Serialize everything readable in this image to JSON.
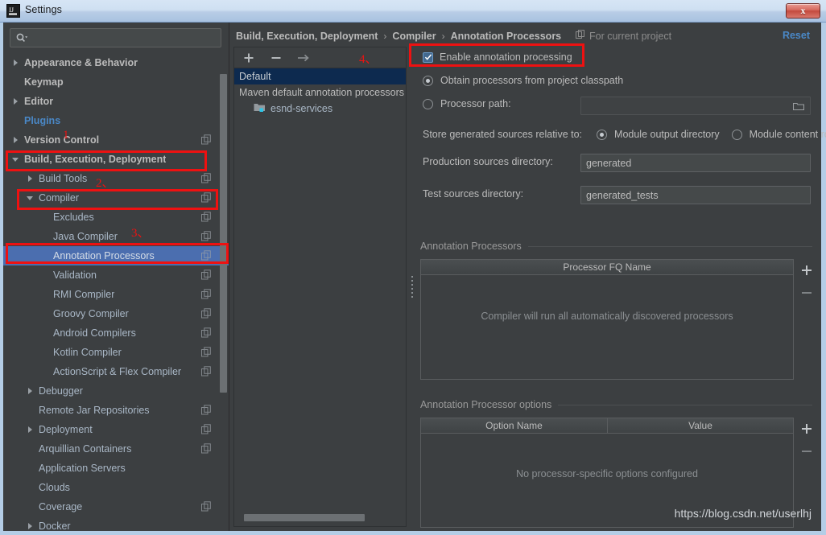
{
  "window": {
    "title": "Settings",
    "icon": "intellij-idea-icon",
    "close_label": "x"
  },
  "search": {
    "placeholder": "",
    "value": "",
    "icon": "search-icon"
  },
  "sidebar": {
    "items": [
      {
        "label": "Appearance & Behavior",
        "indent": 0,
        "arrow": "collapsed",
        "style": "bold",
        "badge": false
      },
      {
        "label": "Keymap",
        "indent": 0,
        "arrow": "none",
        "style": "bold",
        "badge": false
      },
      {
        "label": "Editor",
        "indent": 0,
        "arrow": "collapsed",
        "style": "bold",
        "badge": false
      },
      {
        "label": "Plugins",
        "indent": 0,
        "arrow": "none",
        "style": "accent",
        "badge": false
      },
      {
        "label": "Version Control",
        "indent": 0,
        "arrow": "collapsed",
        "style": "bold",
        "badge": true
      },
      {
        "label": "Build, Execution, Deployment",
        "indent": 0,
        "arrow": "expanded",
        "style": "bold",
        "badge": false
      },
      {
        "label": "Build Tools",
        "indent": 1,
        "arrow": "collapsed",
        "style": "normal",
        "badge": true
      },
      {
        "label": "Compiler",
        "indent": 1,
        "arrow": "expanded",
        "style": "normal",
        "badge": true
      },
      {
        "label": "Excludes",
        "indent": 2,
        "arrow": "none",
        "style": "normal",
        "badge": true
      },
      {
        "label": "Java Compiler",
        "indent": 2,
        "arrow": "none",
        "style": "normal",
        "badge": true
      },
      {
        "label": "Annotation Processors",
        "indent": 2,
        "arrow": "none",
        "style": "selected",
        "badge": true
      },
      {
        "label": "Validation",
        "indent": 2,
        "arrow": "none",
        "style": "normal",
        "badge": true
      },
      {
        "label": "RMI Compiler",
        "indent": 2,
        "arrow": "none",
        "style": "normal",
        "badge": true
      },
      {
        "label": "Groovy Compiler",
        "indent": 2,
        "arrow": "none",
        "style": "normal",
        "badge": true
      },
      {
        "label": "Android Compilers",
        "indent": 2,
        "arrow": "none",
        "style": "normal",
        "badge": true
      },
      {
        "label": "Kotlin Compiler",
        "indent": 2,
        "arrow": "none",
        "style": "normal",
        "badge": true
      },
      {
        "label": "ActionScript & Flex Compiler",
        "indent": 2,
        "arrow": "none",
        "style": "normal",
        "badge": true
      },
      {
        "label": "Debugger",
        "indent": 1,
        "arrow": "collapsed",
        "style": "normal",
        "badge": false
      },
      {
        "label": "Remote Jar Repositories",
        "indent": 1,
        "arrow": "none",
        "style": "normal",
        "badge": true
      },
      {
        "label": "Deployment",
        "indent": 1,
        "arrow": "collapsed",
        "style": "normal",
        "badge": true
      },
      {
        "label": "Arquillian Containers",
        "indent": 1,
        "arrow": "none",
        "style": "normal",
        "badge": true
      },
      {
        "label": "Application Servers",
        "indent": 1,
        "arrow": "none",
        "style": "normal",
        "badge": false
      },
      {
        "label": "Clouds",
        "indent": 1,
        "arrow": "none",
        "style": "normal",
        "badge": false
      },
      {
        "label": "Coverage",
        "indent": 1,
        "arrow": "none",
        "style": "normal",
        "badge": true
      },
      {
        "label": "Docker",
        "indent": 1,
        "arrow": "collapsed",
        "style": "normal",
        "badge": false
      }
    ]
  },
  "header": {
    "breadcrumb": [
      "Build, Execution, Deployment",
      "Compiler",
      "Annotation Processors"
    ],
    "separator": "›",
    "scope_label": "For current project",
    "scope_icon": "project-scope-icon",
    "reset_label": "Reset"
  },
  "profiles": {
    "toolbar": [
      {
        "name": "add-profile-button",
        "icon": "plus-icon"
      },
      {
        "name": "remove-profile-button",
        "icon": "minus-icon"
      },
      {
        "name": "move-to-profile-button",
        "icon": "arrow-right-icon"
      }
    ],
    "rows": [
      {
        "label": "Default",
        "type": "profile",
        "selected": true
      },
      {
        "label": "Maven default annotation processors pr",
        "type": "profile",
        "selected": false
      },
      {
        "label": "esnd-services",
        "type": "module",
        "selected": false
      }
    ]
  },
  "config": {
    "enable_processing": {
      "label": "Enable annotation processing",
      "checked": true
    },
    "obtain_from_classpath": {
      "label": "Obtain processors from project classpath",
      "selected": true
    },
    "processor_path": {
      "label": "Processor path:",
      "selected": false,
      "value": "",
      "browse_icon": "folder-icon"
    },
    "store_relative_label": "Store generated sources relative to:",
    "store_options": [
      {
        "label": "Module output directory",
        "selected": true
      },
      {
        "label": "Module content root",
        "selected": false
      }
    ],
    "production_dir": {
      "label": "Production sources directory:",
      "value": "generated"
    },
    "test_dir": {
      "label": "Test sources directory:",
      "value": "generated_tests"
    },
    "processors_group": {
      "title": "Annotation Processors",
      "columns": [
        "Processor FQ Name"
      ],
      "rows": [],
      "empty_text": "Compiler will run all automatically discovered processors",
      "add_icon": "plus-icon",
      "remove_icon": "minus-icon"
    },
    "options_group": {
      "title": "Annotation Processor options",
      "columns": [
        "Option Name",
        "Value"
      ],
      "rows": [],
      "empty_text": "No processor-specific options configured",
      "add_icon": "plus-icon",
      "remove_icon": "minus-icon"
    }
  },
  "annotations": {
    "numbers": [
      "1",
      "2、",
      "3、",
      "4、"
    ]
  },
  "watermark": "https://blog.csdn.net/userlhj",
  "colors": {
    "accent": "#4a88c7",
    "selection": "#4b6eaf",
    "annotation": "#ee1111",
    "panel_bg": "#3c3f41",
    "text": "#bbbbbb"
  }
}
